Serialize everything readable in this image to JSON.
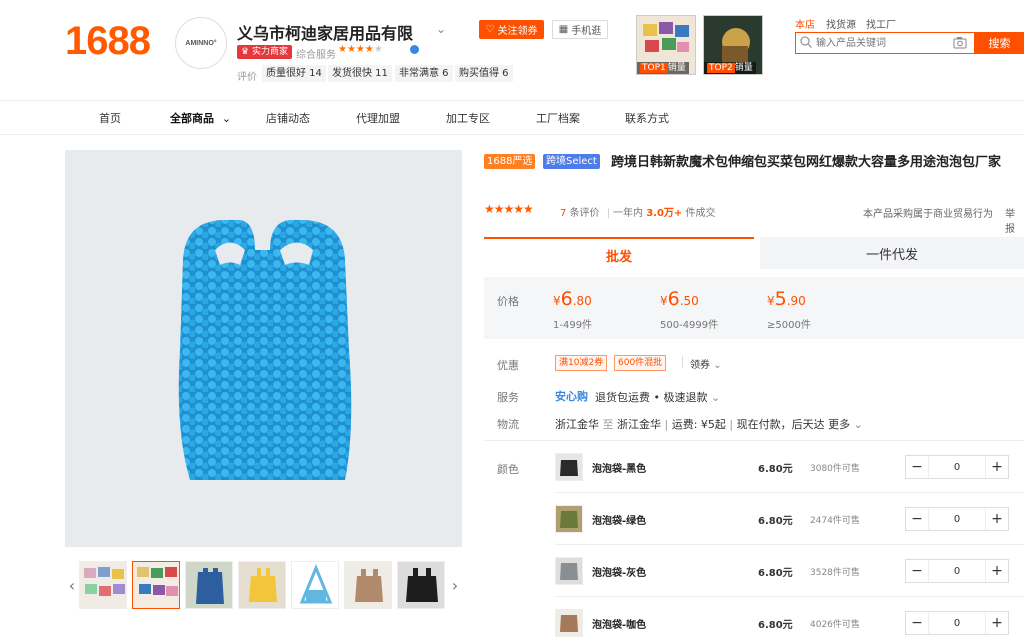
{
  "header": {
    "logo": "1688",
    "shop_logo_text": "AMINNO°",
    "shop_name": "义乌市柯迪家居用品有限",
    "badge": "实力商家",
    "overall_label": "综合服务",
    "overall_stars": 4,
    "rating_label": "评价",
    "rating_tags": [
      {
        "label": "质量很好 14"
      },
      {
        "label": "发货很快 11"
      },
      {
        "label": "非常满意 6"
      },
      {
        "label": "购买值得 6"
      }
    ],
    "follow_label": "关注领券",
    "mobile_label": "手机逛",
    "top_sellers": [
      {
        "rank": "TOP1",
        "label": "销量"
      },
      {
        "rank": "TOP2",
        "label": "销量"
      }
    ],
    "search_tabs": [
      {
        "label": "本店",
        "active": true
      },
      {
        "label": "找货源",
        "active": false
      },
      {
        "label": "找工厂",
        "active": false
      }
    ],
    "search_placeholder": "输入产品关键词",
    "search_button": "搜索"
  },
  "nav": {
    "items": [
      {
        "label": "首页"
      },
      {
        "label": "全部商品",
        "active": true
      },
      {
        "label": "店铺动态"
      },
      {
        "label": "代理加盟"
      },
      {
        "label": "加工专区"
      },
      {
        "label": "工厂档案"
      },
      {
        "label": "联系方式"
      }
    ]
  },
  "product": {
    "badge_1": "1688严选",
    "badge_2": "跨境Select",
    "title": "跨境日韩新款魔术包伸缩包买菜包网红爆款大容量多用途泡泡包厂家",
    "stars": 5,
    "review_count": "7",
    "review_suffix": "条评价",
    "sales_prefix": "一年内",
    "sales_value": "3.0万+",
    "sales_suffix": "件成交",
    "trade_note": "本产品采购属于商业贸易行为",
    "report_label": "举报",
    "tabs": [
      {
        "label": "批发",
        "active": true
      },
      {
        "label": "一件代发",
        "active": false
      }
    ],
    "price_label": "价格",
    "prices": [
      {
        "currency": "¥",
        "int": "6",
        "dec": ".80",
        "range": "1-499件"
      },
      {
        "currency": "¥",
        "int": "6",
        "dec": ".50",
        "range": "500-4999件"
      },
      {
        "currency": "¥",
        "int": "5",
        "dec": ".90",
        "range": "≥5000件"
      }
    ],
    "discount_label": "优惠",
    "coupons": [
      "满10减2券",
      "600件混批"
    ],
    "coupon_get": "领券",
    "service_label": "服务",
    "service_tag": "安心购",
    "service_text": "退货包运费 • 极速退款",
    "logistics_label": "物流",
    "logistics": {
      "from": "浙江金华",
      "to_word": "至",
      "to": "浙江金华",
      "fee": "运费: ¥5起",
      "ship": "现在付款，后天达",
      "more": "更多"
    },
    "color_label": "颜色",
    "variants": [
      {
        "name": "泡泡袋-黑色",
        "price": "6.80元",
        "stock": "3080件可售",
        "qty": "0",
        "swatch": "#2a2a2a"
      },
      {
        "name": "泡泡袋-绿色",
        "price": "6.80元",
        "stock": "2474件可售",
        "qty": "0",
        "swatch": "#6b7a3a"
      },
      {
        "name": "泡泡袋-灰色",
        "price": "6.80元",
        "stock": "3528件可售",
        "qty": "0",
        "swatch": "#8a8f94"
      },
      {
        "name": "泡泡袋-咖色",
        "price": "6.80元",
        "stock": "4026件可售",
        "qty": "0",
        "swatch": "#a57a5a"
      }
    ]
  },
  "gallery": {
    "main_color": "#2aa2e0",
    "thumbs": [
      {
        "color": "#d9a9c0"
      },
      {
        "color": "#e2c26a"
      },
      {
        "color": "#2d5fa0"
      },
      {
        "color": "#f2c53a"
      },
      {
        "color": "#60b8e0"
      },
      {
        "color": "#b08a6a"
      },
      {
        "color": "#1d1d1d"
      }
    ]
  }
}
